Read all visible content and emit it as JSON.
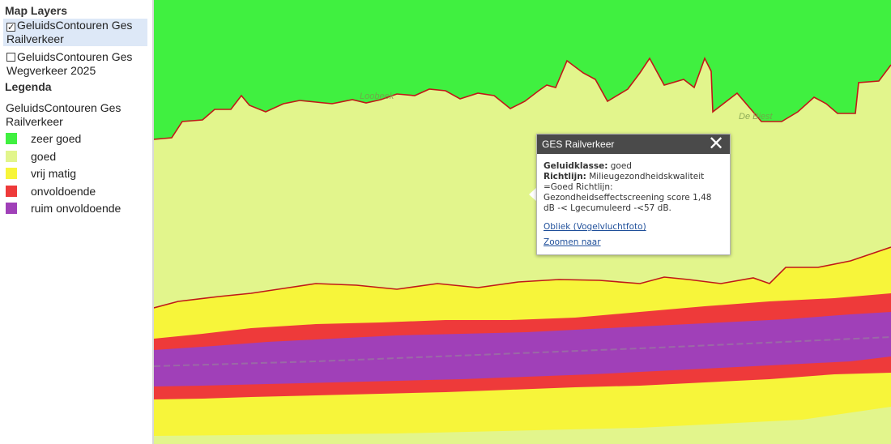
{
  "sidebar": {
    "map_layers_title": "Map Layers",
    "layers": [
      {
        "line1": "GeluidsContouren Ges",
        "line2": "Railverkeer",
        "checked": true,
        "check_glyph": "✓"
      },
      {
        "line1": "GeluidsContouren Ges",
        "line2": "Wegverkeer 2025",
        "checked": false,
        "check_glyph": ""
      }
    ],
    "legenda_title": "Legenda",
    "legend_layer_line1": "GeluidsContouren Ges",
    "legend_layer_line2": "Railverkeer",
    "legend": [
      {
        "label": "zeer goed",
        "color": "#40f040"
      },
      {
        "label": "goed",
        "color": "#e2f58c"
      },
      {
        "label": "vrij matig",
        "color": "#f7f53a"
      },
      {
        "label": "onvoldoende",
        "color": "#ee3a3a"
      },
      {
        "label": "ruim onvoldoende",
        "color": "#a040b8"
      }
    ]
  },
  "map": {
    "place_labels": [
      "Loobeek",
      "De Biest"
    ],
    "contour_line_color": "#c01818"
  },
  "popup": {
    "title": "GES Railverkeer",
    "close_icon": "close-icon",
    "close_glyph": "✕",
    "geluidklasse_label": "Geluidklasse:",
    "geluidklasse_value": " goed",
    "richtlijn_label": "Richtlijn:",
    "richtlijn_value": " Milieugezondheidskwaliteit",
    "text_line2": "=Goed Richtlijn:",
    "text_line3": "Gezondheidseffectscreening score 1,48",
    "text_line4": "dB -< Lgecumuleerd -<57 dB.",
    "link_obliek": "Obliek (Vogelvluchtfoto)",
    "link_zoom": "Zoomen naar"
  }
}
